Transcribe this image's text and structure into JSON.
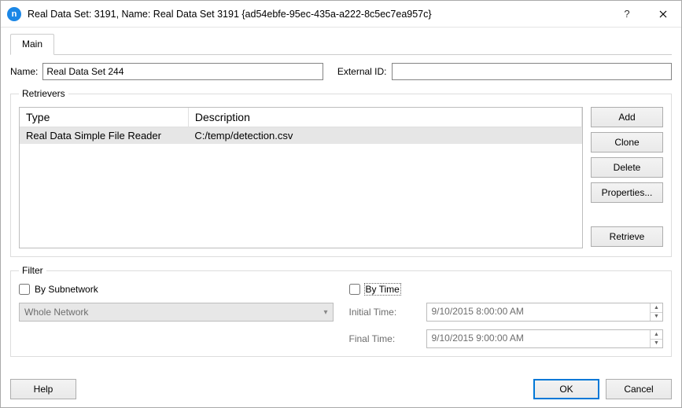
{
  "title": "Real Data Set: 3191, Name: Real Data Set 3191  {ad54ebfe-95ec-435a-a222-8c5ec7ea957c}",
  "tabs": {
    "main": "Main"
  },
  "fields": {
    "name_label": "Name:",
    "name_value": "Real Data Set 244",
    "external_id_label": "External ID:",
    "external_id_value": ""
  },
  "retrievers": {
    "legend": "Retrievers",
    "columns": {
      "type": "Type",
      "description": "Description"
    },
    "rows": [
      {
        "type": "Real Data Simple File Reader",
        "description": "C:/temp/detection.csv"
      }
    ],
    "buttons": {
      "add": "Add",
      "clone": "Clone",
      "delete": "Delete",
      "properties": "Properties...",
      "retrieve": "Retrieve"
    }
  },
  "filter": {
    "legend": "Filter",
    "by_subnetwork_label": "By Subnetwork",
    "subnetwork_value": "Whole Network",
    "by_time_label": "By Time",
    "initial_time_label": "Initial Time:",
    "initial_time_value": "9/10/2015 8:00:00 AM",
    "final_time_label": "Final Time:",
    "final_time_value": "9/10/2015 9:00:00 AM"
  },
  "footer": {
    "help": "Help",
    "ok": "OK",
    "cancel": "Cancel"
  }
}
